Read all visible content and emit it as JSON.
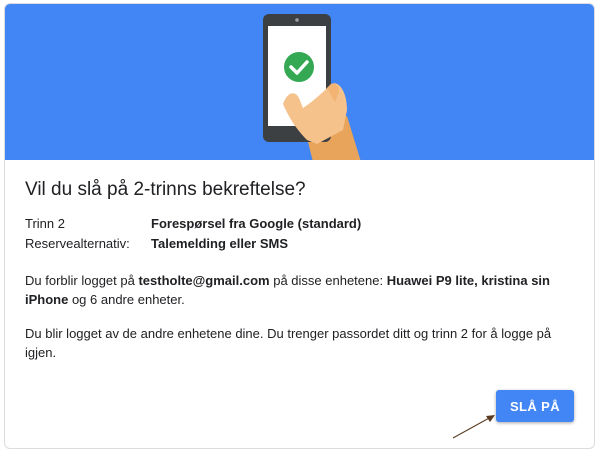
{
  "dialog": {
    "title": "Vil du slå på 2-trinns bekreftelse?",
    "details": [
      {
        "label": "Trinn 2",
        "value": "Forespørsel fra Google (standard)"
      },
      {
        "label": "Reservealternativ:",
        "value": "Talemelding eller SMS"
      }
    ],
    "p1": {
      "pre": "Du forblir logget på ",
      "email": "testholte@gmail.com",
      "mid": " på disse enhetene: ",
      "devices": "Huawei P9 lite, kristina sin iPhone",
      "post": " og 6 andre enheter."
    },
    "p2": "Du blir logget av de andre enhetene dine. Du trenger passordet ditt og trinn 2 for å logge på igjen.",
    "confirm_label": "SLÅ PÅ"
  },
  "colors": {
    "banner": "#4285f4",
    "button": "#4285f4",
    "check": "#34a853",
    "hand": "#f6c28b",
    "phone": "#3c4043"
  },
  "icons": [
    "phone-illustration",
    "checkmark-icon",
    "annotation-arrow"
  ]
}
